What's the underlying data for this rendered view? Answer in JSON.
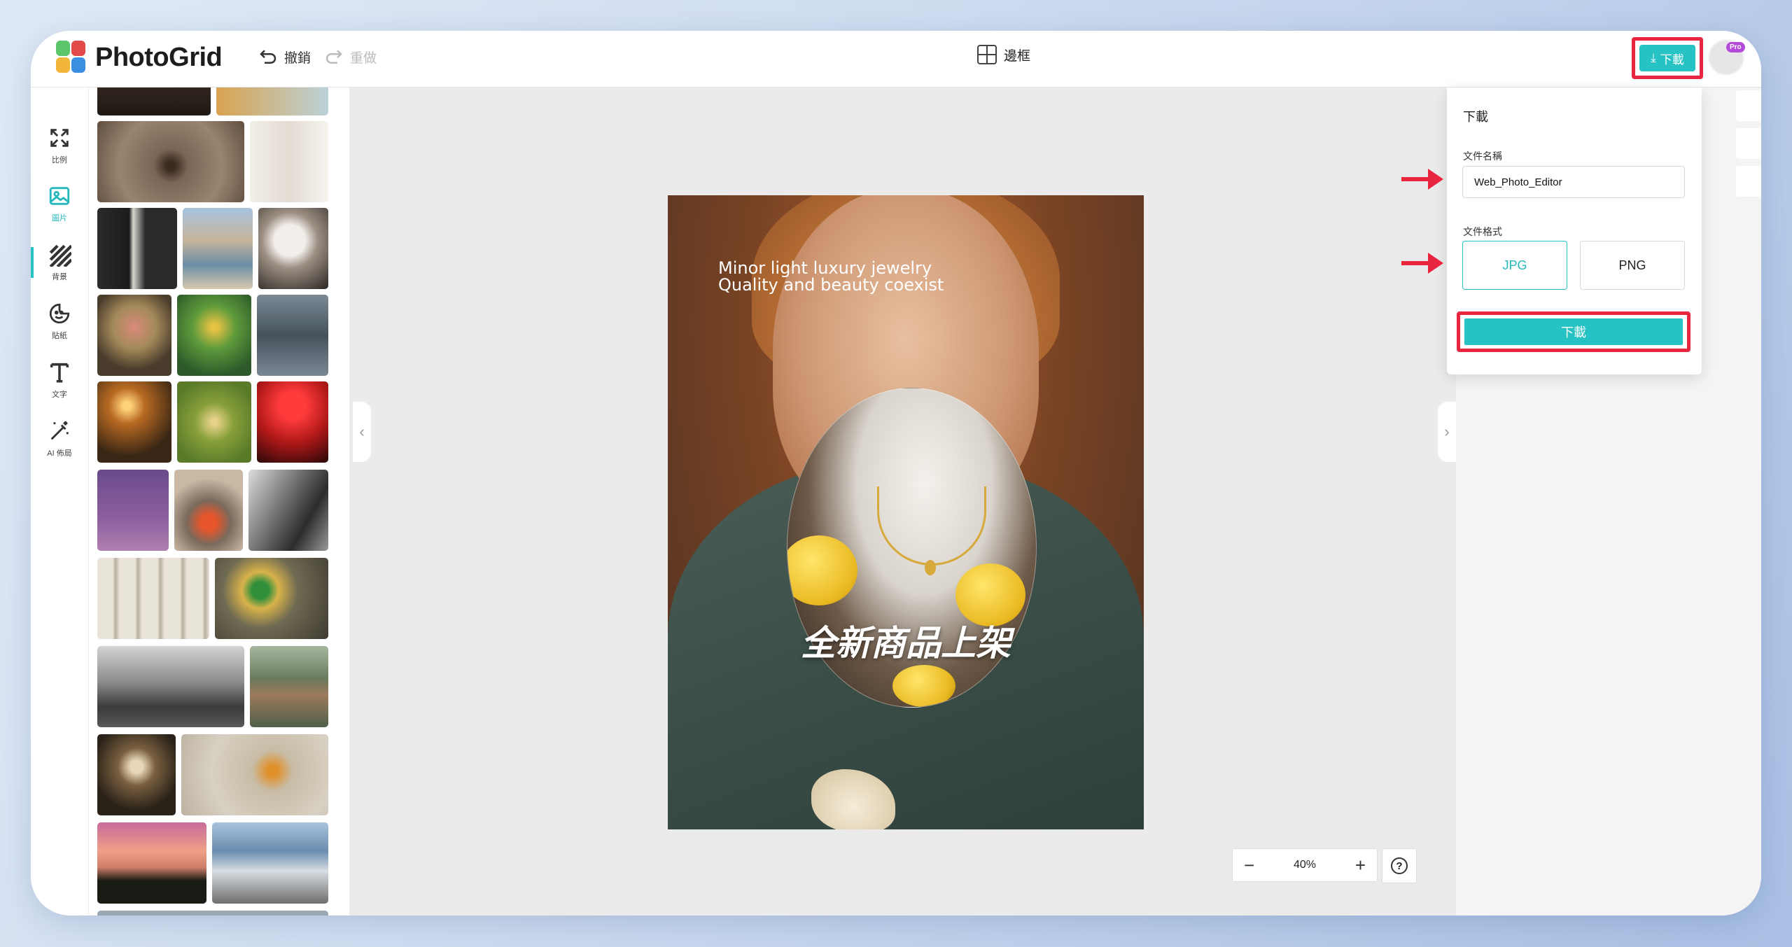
{
  "app": {
    "logo_text": "PhotoGrid"
  },
  "toolbar": {
    "undo_label": "撤銷",
    "redo_label": "重做",
    "frame_label": "邊框",
    "download_label": "下載",
    "pro_badge": "Pro"
  },
  "sidebar": {
    "items": [
      {
        "label": "比例",
        "icon": "resize-icon"
      },
      {
        "label": "圖片",
        "icon": "image-icon",
        "active": true
      },
      {
        "label": "背景",
        "icon": "stripes-icon"
      },
      {
        "label": "貼紙",
        "icon": "sticker-icon"
      },
      {
        "label": "文字",
        "icon": "text-icon"
      },
      {
        "label": "AI 佈局",
        "icon": "magic-wand-icon"
      }
    ]
  },
  "canvas": {
    "text_line1": "Minor light luxury jewelry",
    "text_line2": "Quality and beauty coexist",
    "headline": "全新商品上架"
  },
  "zoom": {
    "minus": "−",
    "value": "40%",
    "plus": "+",
    "help": "?"
  },
  "download_panel": {
    "title": "下載",
    "filename_label": "文件名稱",
    "filename_value": "Web_Photo_Editor",
    "format_label": "文件格式",
    "formats": [
      "JPG",
      "PNG"
    ],
    "selected_format": "JPG",
    "submit_label": "下載"
  },
  "colors": {
    "accent": "#26c2c4",
    "highlight": "#e8263f"
  }
}
